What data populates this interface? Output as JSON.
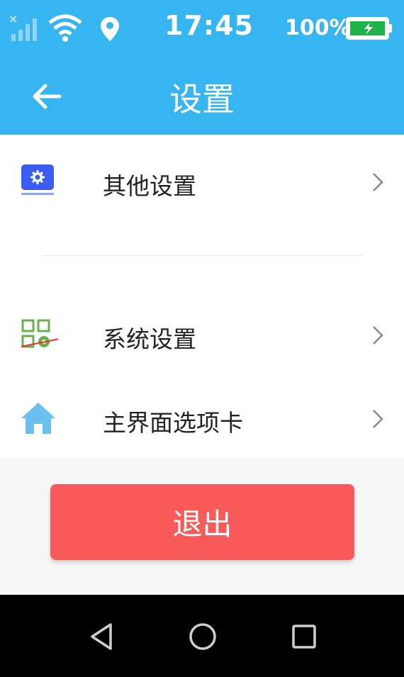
{
  "status_bar": {
    "time": "17:45",
    "battery_percent": "100%",
    "icons": [
      "signal-icon",
      "wifi-icon",
      "location-icon",
      "battery-icon"
    ]
  },
  "app_bar": {
    "title": "设置",
    "back_icon": "arrow-left-icon"
  },
  "menu": {
    "items": [
      {
        "label": "其他设置",
        "icon": "gear-card-icon"
      },
      {
        "label": "系统设置",
        "icon": "grid-gear-icon"
      },
      {
        "label": "主界面选项卡",
        "icon": "home-icon"
      }
    ]
  },
  "exit_button": {
    "label": "退出"
  },
  "nav_bar": {
    "buttons": [
      "back-triangle-icon",
      "home-circle-icon",
      "recents-square-icon"
    ]
  },
  "colors": {
    "primary": "#36b5f0",
    "exit": "#f85a5a",
    "icon_blue": "#3a5cf0",
    "icon_green": "#6ab04c",
    "icon_lightblue": "#6cc0f0"
  }
}
